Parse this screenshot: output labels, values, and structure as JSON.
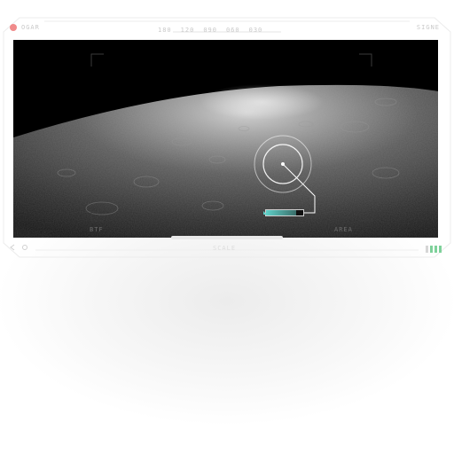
{
  "hud": {
    "top_left_label": "OGAR",
    "top_right_label": "SIGNE",
    "top_center_ticks": [
      "180",
      "120",
      "090",
      "060",
      "030"
    ],
    "bottom_left_label": "BTF",
    "bottom_right_label": "AREA",
    "bottom_center_label": "SCALE"
  },
  "icons": {
    "rec": "record-dot-icon",
    "crosshair": "crosshair-target-icon",
    "signal": "signal-bars-icon",
    "nav_up": "nav-up-caret-icon",
    "left_arrows": "left-arrows-icon"
  },
  "target": {
    "scan_level": 0.8
  },
  "colors": {
    "accent": "#5fd0c8",
    "signal_active": "#7ed19a",
    "signal_inactive": "#d6d6d6",
    "rec": "#f08a8a"
  }
}
